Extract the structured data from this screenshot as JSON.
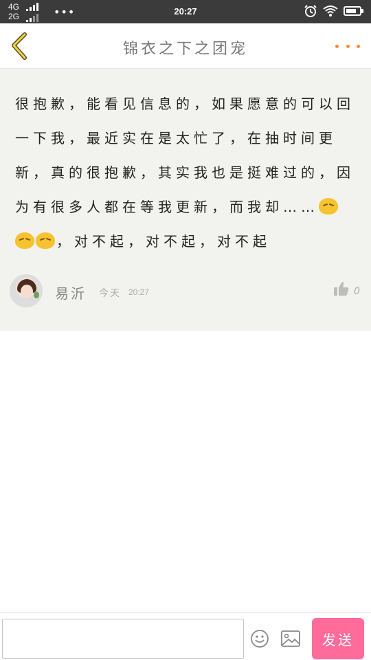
{
  "status_bar": {
    "network_1": "4G",
    "network_2": "2G",
    "dots": "•••",
    "time": "20:27"
  },
  "header": {
    "title": "锦衣之下之团宠",
    "accent_color": "#ff8a33",
    "back_icon": "chevron-left-icon",
    "more_icon": "more-dots-icon"
  },
  "comment": {
    "text_part_1": "很抱歉，能看见信息的，如果愿意的可以回一下我，最近实在是太忙了，在抽时间更新，真的很抱歉，其实我也是挺难过的，因为有很多人都在等我更新，而我却……",
    "text_part_2": "，对不起，对不起，对不起",
    "author": "易沂",
    "day": "今天",
    "time": "20:27",
    "likes": "0"
  },
  "input_bar": {
    "input_value": "",
    "input_placeholder": "",
    "send_label": "发送",
    "send_color": "#ff6b9a"
  }
}
